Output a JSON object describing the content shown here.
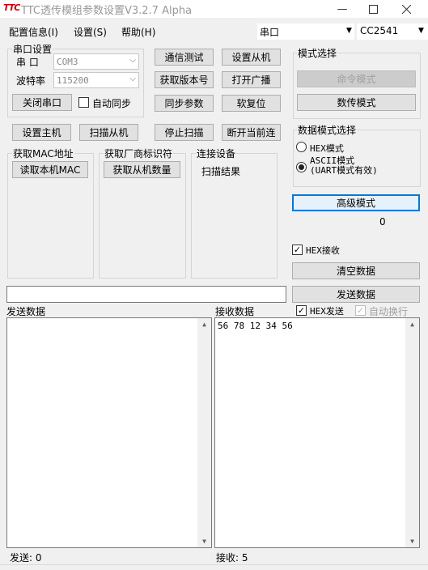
{
  "window": {
    "logo": "TTC",
    "title": "TTC透传模组参数设置V3.2.7 Alpha"
  },
  "menu": {
    "config": "配置信息(I)",
    "settings": "设置(S)",
    "help": "帮助(H)",
    "port_type": "串口",
    "chip": "CC2541"
  },
  "serial": {
    "group_label": "串口设置",
    "port_label": "串  口",
    "port_value": "COM3",
    "baud_label": "波特率",
    "baud_value": "115200",
    "close_button": "关闭串口",
    "auto_sync": "自动同步"
  },
  "buttons": {
    "comm_test": "通信测试",
    "set_slave": "设置从机",
    "get_version": "获取版本号",
    "open_broadcast": "打开广播",
    "sync_params": "同步参数",
    "soft_reset": "软复位",
    "set_master": "设置主机",
    "scan_slave": "扫描从机",
    "stop_scan": "停止扫描",
    "disconnect": "断开当前连"
  },
  "mode": {
    "group_label": "模式选择",
    "command_mode": "命令模式",
    "transparent_mode": "数传模式"
  },
  "data_mode": {
    "group_label": "数据模式选择",
    "hex_mode": "HEX模式",
    "ascii_mode_line1": "ASCII模式",
    "ascii_mode_line2": "(UART模式有效)",
    "advanced_button": "高级模式",
    "advanced_value": "0"
  },
  "lower": {
    "mac_label": "获取MAC地址",
    "mac_button": "读取本机MAC",
    "vendor_label": "获取厂商标识符",
    "vendor_button": "获取从机数量",
    "connected_label": "连接设备",
    "scan_result": "扫描结果"
  },
  "rx_options": {
    "hex_receive": "HEX接收",
    "clear_button": "清空数据",
    "send_button": "发送数据",
    "send_input": ""
  },
  "send_panel": {
    "label": "发送数据",
    "content": "",
    "counter": "发送: 0"
  },
  "recv_panel": {
    "label": "接收数据",
    "hex_send": "HEX发送",
    "auto_wrap": "自动换行",
    "content": "56 78 12 34 56",
    "counter": "接收:  5"
  }
}
